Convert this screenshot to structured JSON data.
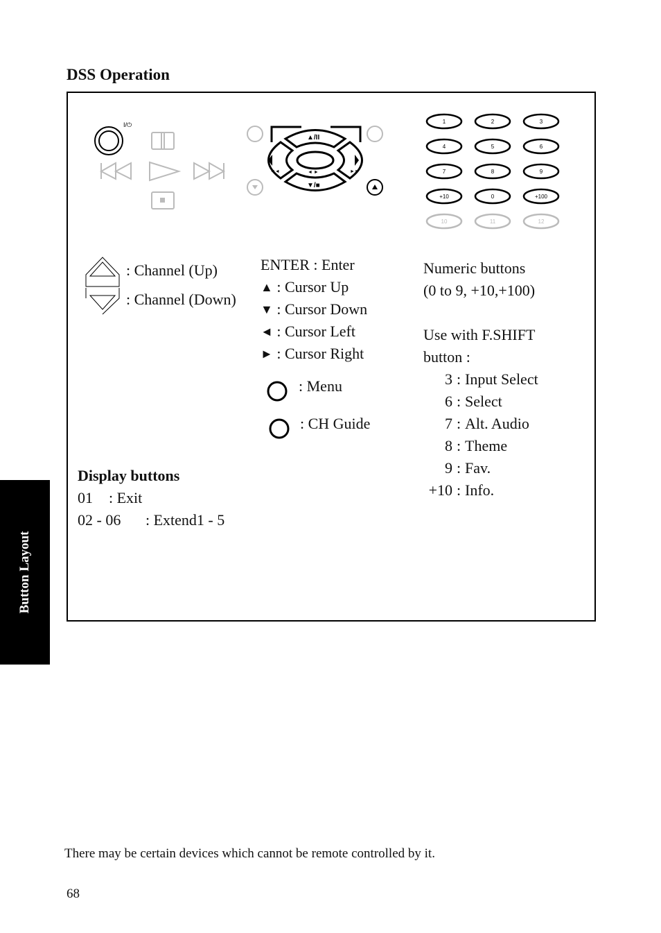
{
  "section_title": "DSS Operation",
  "side_tab": "Button Layout",
  "remote_diagram": {
    "power_label": "I/⏻",
    "transport_icons": [
      "pause-icon",
      "rewind-icon",
      "play-icon",
      "fast-forward-icon",
      "stop-icon"
    ],
    "cursor_pad": {
      "up_label": "▲/II",
      "down_label": "▼/■",
      "left_sub": "◄◄",
      "right_sub": "►►",
      "center_sub": "◄ ►"
    },
    "numeric_keys": [
      [
        "1",
        "2",
        "3"
      ],
      [
        "4",
        "5",
        "6"
      ],
      [
        "7",
        "8",
        "9"
      ],
      [
        "+10",
        "0",
        "+100"
      ],
      [
        "10",
        "11",
        "12"
      ]
    ]
  },
  "channel": {
    "up": ": Channel (Up)",
    "down": ": Channel (Down)"
  },
  "cursor_legend": [
    ": Enter",
    ": Cursor Up",
    ": Cursor Down",
    ": Cursor Left",
    ": Cursor Right"
  ],
  "cursor_keys": [
    "ENTER",
    "▲",
    "▼",
    "◄",
    "►"
  ],
  "menu_label": ": Menu",
  "guide_label": ": CH Guide",
  "numeric_info": {
    "line1": "Numeric buttons",
    "line2": "(0 to 9, +10,+100)",
    "shift1": "Use with F.SHIFT",
    "shift2": "button :",
    "shift_items": [
      {
        "key": "3",
        "label": "Input Select"
      },
      {
        "key": "6",
        "label": "Select"
      },
      {
        "key": "7",
        "label": "Alt. Audio"
      },
      {
        "key": "8",
        "label": "Theme"
      },
      {
        "key": "9",
        "label": "Fav."
      },
      {
        "key": "+10",
        "label": "Info."
      }
    ]
  },
  "display_buttons": {
    "title": "Display buttons",
    "items": [
      {
        "key": "01",
        "label": ": Exit"
      },
      {
        "key": "02 - 06",
        "label": ": Extend1 - 5"
      }
    ]
  },
  "footnote": "There may be certain devices which cannot be remote controlled by it.",
  "page_number": "68"
}
